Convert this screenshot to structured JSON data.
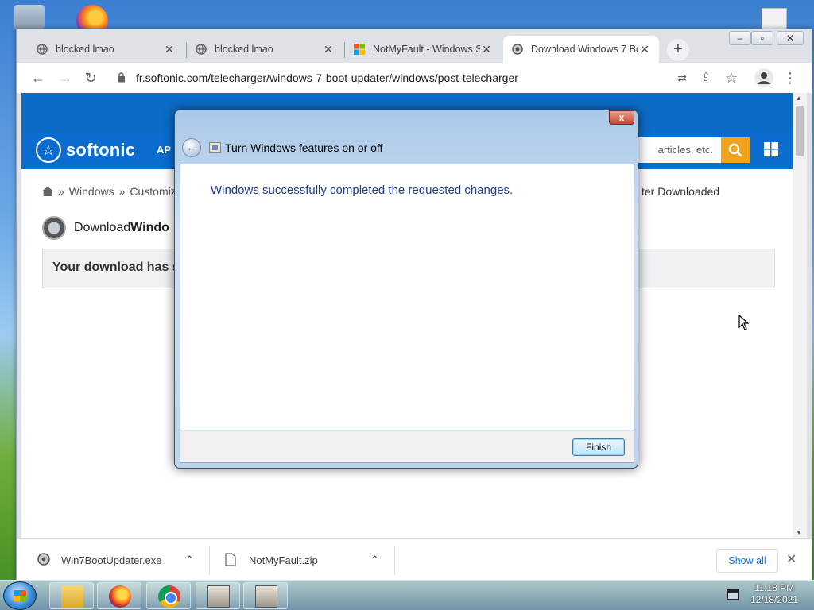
{
  "desktop": {
    "icons": [
      "recycle-bin-icon",
      "firefox-icon",
      "file-icon"
    ]
  },
  "browser": {
    "tabs": [
      {
        "label": "blocked lmao",
        "icon": "globe-icon",
        "active": false
      },
      {
        "label": "blocked lmao",
        "icon": "globe-icon",
        "active": false
      },
      {
        "label": "NotMyFault - Windows S",
        "icon": "microsoft-icon",
        "active": false
      },
      {
        "label": "Download Windows 7 Bo",
        "icon": "softonic-icon",
        "active": true
      }
    ],
    "new_tab": "+",
    "window_controls": {
      "minimize": "–",
      "restore": "▫",
      "close": "✕"
    },
    "address": "fr.softonic.com/telecharger/windows-7-boot-updater/windows/post-telecharger"
  },
  "site": {
    "brand": "softonic",
    "nav_partial": "AP",
    "search_placeholder": "articles, etc.",
    "breadcrumb": {
      "home": "home-icon",
      "items": [
        "Windows",
        "Customiz"
      ],
      "sep": "»"
    },
    "breadcrumb_right": "ter Downloaded",
    "download_title_prefix": "Download ",
    "download_title_bold": "Windo",
    "notice_text": "Your download has s"
  },
  "downloads": {
    "items": [
      {
        "name": "Win7BootUpdater.exe",
        "icon": "app-disc-icon"
      },
      {
        "name": "NotMyFault.zip",
        "icon": "file-icon"
      }
    ],
    "show_all": "Show all",
    "close": "✕"
  },
  "dialog": {
    "title": "Turn Windows features on or off",
    "message": "Windows successfully completed the requested changes.",
    "finish_label": "Finish",
    "close": "x"
  },
  "taskbar": {
    "items": [
      "explorer-icon",
      "firefox-icon",
      "chrome-icon",
      "app-icon",
      "app-icon"
    ],
    "time": "11:18 PM",
    "date": "12/18/2021"
  }
}
